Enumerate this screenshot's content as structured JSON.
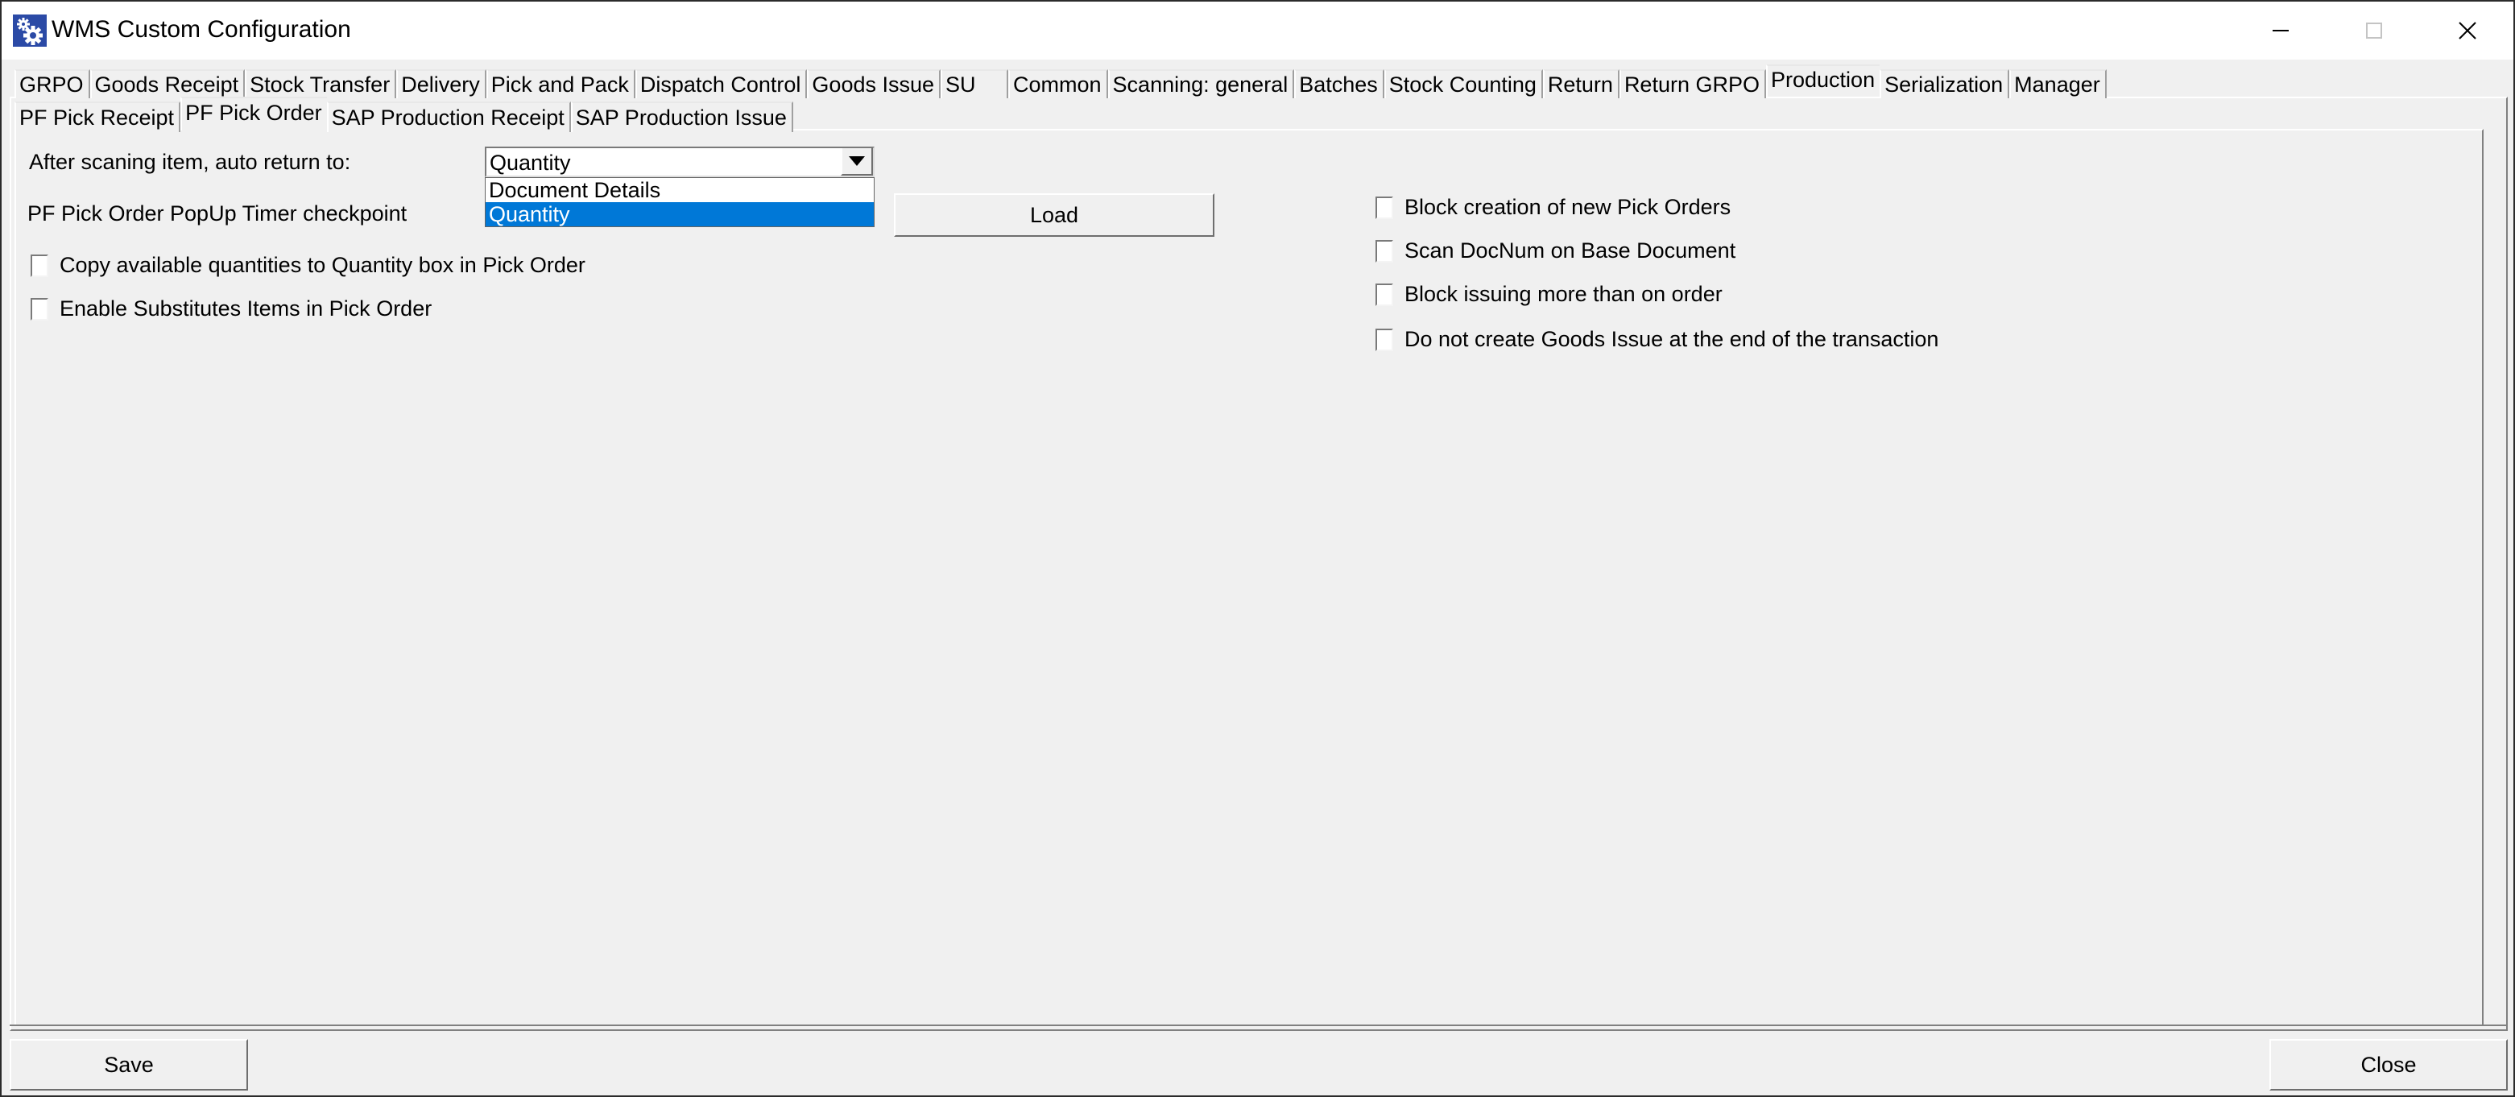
{
  "window": {
    "title": "WMS Custom Configuration",
    "icon": "gears-icon",
    "controls": {
      "minimize": "minimize-icon",
      "maximize": "maximize-icon",
      "close": "close-icon",
      "close_glyph": "✕"
    }
  },
  "tabs_top": [
    {
      "label": "GRPO",
      "active": false
    },
    {
      "label": "Goods Receipt",
      "active": false
    },
    {
      "label": "Stock Transfer",
      "active": false
    },
    {
      "label": "Delivery",
      "active": false
    },
    {
      "label": "Pick and Pack",
      "active": false
    },
    {
      "label": "Dispatch Control",
      "active": false
    },
    {
      "label": "Goods Issue",
      "active": false
    },
    {
      "label": "SU",
      "active": false
    },
    {
      "label": "Common",
      "active": false
    },
    {
      "label": "Scanning: general",
      "active": false
    },
    {
      "label": "Batches",
      "active": false
    },
    {
      "label": "Stock Counting",
      "active": false
    },
    {
      "label": "Return",
      "active": false
    },
    {
      "label": "Return GRPO",
      "active": false
    },
    {
      "label": "Production",
      "active": true
    },
    {
      "label": "Serialization",
      "active": false
    },
    {
      "label": "Manager",
      "active": false
    }
  ],
  "tabs_sub": [
    {
      "label": "PF Pick Receipt",
      "active": false
    },
    {
      "label": "PF Pick Order",
      "active": true
    },
    {
      "label": "SAP Production Receipt",
      "active": false
    },
    {
      "label": "SAP Production Issue",
      "active": false
    }
  ],
  "form": {
    "auto_return": {
      "label": "After scaning item, auto return to:",
      "value": "Quantity",
      "dropdown_open": true,
      "options": [
        {
          "label": "Document Details",
          "selected": false
        },
        {
          "label": "Quantity",
          "selected": true
        }
      ]
    },
    "timer_checkpoint": {
      "label": "PF Pick Order PopUp Timer checkpoint",
      "button_label": "Load"
    },
    "left_checkboxes": [
      {
        "label": "Copy available quantities to Quantity box in Pick Order",
        "checked": false
      },
      {
        "label": "Enable Substitutes Items in Pick Order",
        "checked": false
      }
    ],
    "right_checkboxes": [
      {
        "label": "Block creation of new Pick Orders",
        "checked": false
      },
      {
        "label": "Scan DocNum on Base Document",
        "checked": false
      },
      {
        "label": "Block issuing more than on order",
        "checked": false
      },
      {
        "label": "Do not create Goods Issue at the end of the transaction",
        "checked": false
      }
    ]
  },
  "footer": {
    "save_label": "Save",
    "close_label": "Close"
  },
  "colors": {
    "selection": "#0078d7",
    "window_bg": "#f0f0f0",
    "icon_bg": "#2b4aa6"
  }
}
